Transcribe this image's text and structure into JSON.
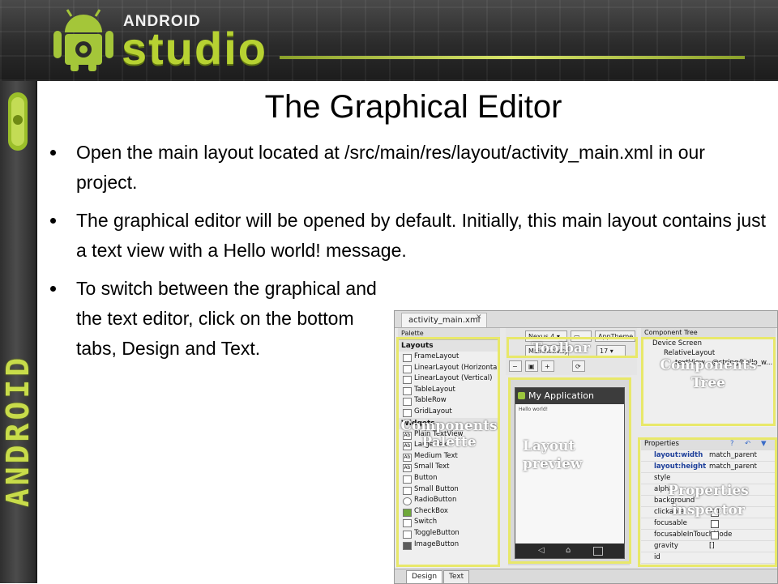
{
  "banner": {
    "logo_small": "ANDROID",
    "logo_big": "studio"
  },
  "side_strip": {
    "word": "ANDROID"
  },
  "title": "The Graphical Editor",
  "bullets": [
    "Open the main layout located at /src/main/res/layout/activity_main.xml in our project.",
    "The graphical editor will be opened by default. Initially, this main layout contains just a text view with a Hello world! message.",
    "To switch between the graphical and the text editor, click on the bottom tabs, Design and Text."
  ],
  "ide": {
    "file_tab": "activity_main.xml",
    "palette": {
      "header": "Palette",
      "categories": [
        {
          "name": "Layouts",
          "items": [
            "FrameLayout",
            "LinearLayout (Horizontal)",
            "LinearLayout (Vertical)",
            "TableLayout",
            "TableRow",
            "GridLayout"
          ]
        },
        {
          "name": "Widgets",
          "items": [
            "Plain TextView",
            "Large Text",
            "Medium Text",
            "Small Text",
            "Button",
            "Small Button",
            "RadioButton",
            "CheckBox",
            "Switch",
            "ToggleButton",
            "ImageButton"
          ]
        }
      ]
    },
    "toolbar": {
      "device": "Nexus 4",
      "theme": "AppTheme",
      "activity": "MainActivity",
      "api": "17"
    },
    "preview": {
      "app_name": "My Application",
      "hello_text": "Hello world!"
    },
    "component_tree": {
      "header": "Component Tree",
      "rows": [
        "Device Screen",
        "RelativeLayout",
        "textView - @string/hello_w..."
      ]
    },
    "properties": {
      "header": "Properties",
      "rows": [
        {
          "key": "layout:width",
          "value": "match_parent",
          "type": "text"
        },
        {
          "key": "layout:height",
          "value": "match_parent",
          "type": "text"
        },
        {
          "key": "style",
          "value": "",
          "type": "text"
        },
        {
          "key": "alpha",
          "value": "",
          "type": "text"
        },
        {
          "key": "background",
          "value": "",
          "type": "text"
        },
        {
          "key": "clickable",
          "value": "",
          "type": "check"
        },
        {
          "key": "focusable",
          "value": "",
          "type": "check"
        },
        {
          "key": "focusableInTouchMode",
          "value": "",
          "type": "check"
        },
        {
          "key": "gravity",
          "value": "[]",
          "type": "text"
        },
        {
          "key": "id",
          "value": "",
          "type": "text"
        }
      ]
    },
    "overlays": {
      "toolbar": "Toolbar",
      "components_tree": "Components\nTree",
      "palette": "Components\nPalette",
      "layout_preview": "Layout\npreview",
      "properties": "Properties\ninspector"
    },
    "bottom_tabs": [
      "Design",
      "Text"
    ]
  }
}
